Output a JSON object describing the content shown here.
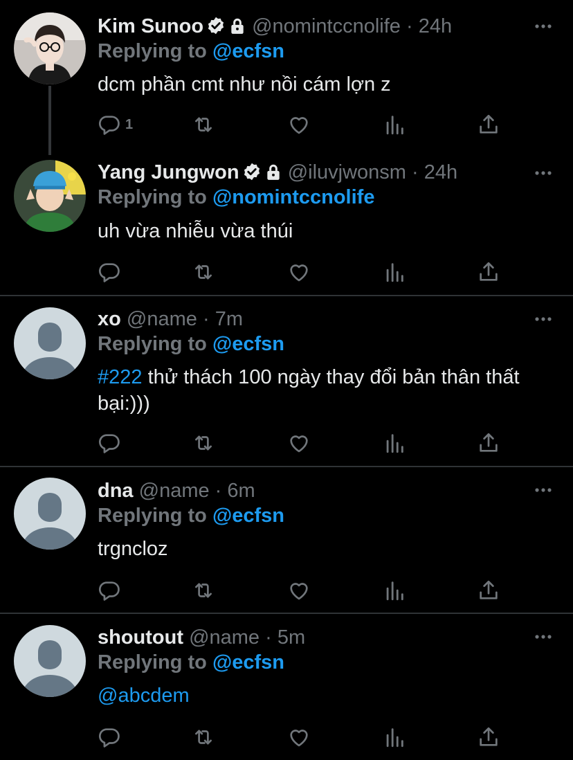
{
  "colors": {
    "background": "#000000",
    "text": "#e7e9ea",
    "muted": "#71767b",
    "link": "#1d9bf0",
    "divider": "#2f3336"
  },
  "tweets": [
    {
      "name": "Kim Sunoo",
      "handle": "@nomintccnolife",
      "time": "24h",
      "verified": true,
      "locked": true,
      "replying_label": "Replying to",
      "replying_to": "@ecfsn",
      "text": "dcm phần cmt như nồi cám lợn z",
      "reply_count": "1"
    },
    {
      "name": "Yang Jungwon",
      "handle": "@iluvjwonsm",
      "time": "24h",
      "verified": true,
      "locked": true,
      "replying_label": "Replying to",
      "replying_to": "@nomintccnolife",
      "text": "uh vừa nhiễu vừa thúi",
      "reply_count": ""
    },
    {
      "name": "xo",
      "handle": "@name",
      "time": "7m",
      "replying_label": "Replying to",
      "replying_to": "@ecfsn",
      "hashtag": "#222",
      "text": " thử thách 100 ngày thay đổi bản thân thất bại:)))",
      "reply_count": ""
    },
    {
      "name": "dna",
      "handle": "@name",
      "time": "6m",
      "replying_label": "Replying to",
      "replying_to": "@ecfsn",
      "text": "trgncloz",
      "reply_count": ""
    },
    {
      "name": "shoutout",
      "handle": "@name",
      "time": "5m",
      "replying_label": "Replying to",
      "replying_to": "@ecfsn",
      "mention_text": "@abcdem",
      "reply_count": ""
    }
  ],
  "dot_separator": "·"
}
